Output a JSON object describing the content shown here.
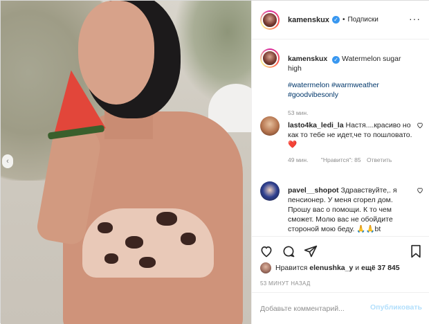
{
  "header": {
    "username": "kamenskux",
    "separator": "•",
    "follow_label": "Подписки",
    "more_label": "···"
  },
  "caption": {
    "username": "kamenskux",
    "text": "Watermelon sugar high",
    "tags": [
      "#watermelon",
      "#warmweather",
      "#goodvibesonly"
    ],
    "time": "53 мин."
  },
  "comments": [
    {
      "username": "lasto4ka_ledi_la",
      "text": "Настя....красиво но как то тебе не идет,че то пошловато.",
      "emoji": "❤️",
      "time": "49 мин.",
      "likes": "\"Нравится\": 85",
      "reply_label": "Ответить"
    },
    {
      "username": "pavel__shopot",
      "text": "Здравствуйте,. я пенсионер. У меня сгорел дом. Прошу вас о помощи. К то чем сможет. Молю вас не обойдите стороной мою беду.",
      "emoji": "🙏🙏bt"
    }
  ],
  "likes": {
    "prefix": "Нравится",
    "user": "elenushka_y",
    "middle": "и",
    "rest": "ещё 37 845"
  },
  "timestamp": "53 МИНУТ НАЗАД",
  "add_comment": {
    "placeholder": "Добавьте комментарий...",
    "post_label": "Опубликовать"
  },
  "colors": {
    "link": "#00376b",
    "verified": "#3897f0",
    "muted": "#8e8e8e",
    "post_disabled": "#b2dffc"
  }
}
